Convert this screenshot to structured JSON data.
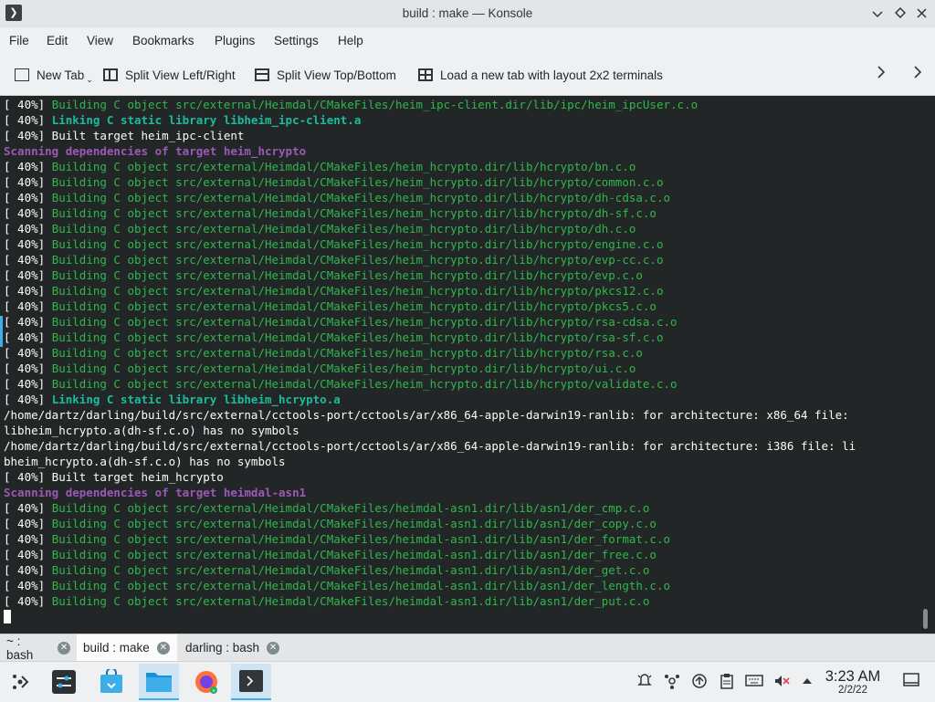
{
  "window": {
    "title": "build : make — Konsole",
    "app_icon": "terminal-icon",
    "controls": [
      "chevron-down-icon",
      "diamond-icon",
      "close-icon"
    ]
  },
  "menu": [
    "File",
    "Edit",
    "View",
    "Bookmarks",
    "Plugins",
    "Settings",
    "Help"
  ],
  "toolbar": {
    "new_tab": "New Tab",
    "split_lr": "Split View Left/Right",
    "split_tb": "Split View Top/Bottom",
    "layout_2x2": "Load a new tab with layout 2x2 terminals"
  },
  "terminal": {
    "lines": [
      {
        "prefix": "[ 40%] ",
        "text": "Building C object src/external/Heimdal/CMakeFiles/heim_ipc-client.dir/lib/ipc/heim_ipcUser.c.o",
        "style": "green"
      },
      {
        "prefix": "[ 40%] ",
        "text": "Linking C static library libheim_ipc-client.a",
        "style": "teal"
      },
      {
        "prefix": "",
        "text": "[ 40%] Built target heim_ipc-client",
        "style": "white"
      },
      {
        "prefix": "",
        "text": "Scanning dependencies of target heim_hcrypto",
        "style": "purple"
      },
      {
        "prefix": "[ 40%] ",
        "text": "Building C object src/external/Heimdal/CMakeFiles/heim_hcrypto.dir/lib/hcrypto/bn.c.o",
        "style": "green"
      },
      {
        "prefix": "[ 40%] ",
        "text": "Building C object src/external/Heimdal/CMakeFiles/heim_hcrypto.dir/lib/hcrypto/common.c.o",
        "style": "green"
      },
      {
        "prefix": "[ 40%] ",
        "text": "Building C object src/external/Heimdal/CMakeFiles/heim_hcrypto.dir/lib/hcrypto/dh-cdsa.c.o",
        "style": "green"
      },
      {
        "prefix": "[ 40%] ",
        "text": "Building C object src/external/Heimdal/CMakeFiles/heim_hcrypto.dir/lib/hcrypto/dh-sf.c.o",
        "style": "green"
      },
      {
        "prefix": "[ 40%] ",
        "text": "Building C object src/external/Heimdal/CMakeFiles/heim_hcrypto.dir/lib/hcrypto/dh.c.o",
        "style": "green"
      },
      {
        "prefix": "[ 40%] ",
        "text": "Building C object src/external/Heimdal/CMakeFiles/heim_hcrypto.dir/lib/hcrypto/engine.c.o",
        "style": "green"
      },
      {
        "prefix": "[ 40%] ",
        "text": "Building C object src/external/Heimdal/CMakeFiles/heim_hcrypto.dir/lib/hcrypto/evp-cc.c.o",
        "style": "green"
      },
      {
        "prefix": "[ 40%] ",
        "text": "Building C object src/external/Heimdal/CMakeFiles/heim_hcrypto.dir/lib/hcrypto/evp.c.o",
        "style": "green"
      },
      {
        "prefix": "[ 40%] ",
        "text": "Building C object src/external/Heimdal/CMakeFiles/heim_hcrypto.dir/lib/hcrypto/pkcs12.c.o",
        "style": "green"
      },
      {
        "prefix": "[ 40%] ",
        "text": "Building C object src/external/Heimdal/CMakeFiles/heim_hcrypto.dir/lib/hcrypto/pkcs5.c.o",
        "style": "green"
      },
      {
        "prefix": "[ 40%] ",
        "text": "Building C object src/external/Heimdal/CMakeFiles/heim_hcrypto.dir/lib/hcrypto/rsa-cdsa.c.o",
        "style": "green"
      },
      {
        "prefix": "[ 40%] ",
        "text": "Building C object src/external/Heimdal/CMakeFiles/heim_hcrypto.dir/lib/hcrypto/rsa-sf.c.o",
        "style": "green"
      },
      {
        "prefix": "[ 40%] ",
        "text": "Building C object src/external/Heimdal/CMakeFiles/heim_hcrypto.dir/lib/hcrypto/rsa.c.o",
        "style": "green"
      },
      {
        "prefix": "[ 40%] ",
        "text": "Building C object src/external/Heimdal/CMakeFiles/heim_hcrypto.dir/lib/hcrypto/ui.c.o",
        "style": "green"
      },
      {
        "prefix": "[ 40%] ",
        "text": "Building C object src/external/Heimdal/CMakeFiles/heim_hcrypto.dir/lib/hcrypto/validate.c.o",
        "style": "green"
      },
      {
        "prefix": "[ 40%] ",
        "text": "Linking C static library libheim_hcrypto.a",
        "style": "teal"
      },
      {
        "prefix": "",
        "text": "/home/dartz/darling/build/src/external/cctools-port/cctools/ar/x86_64-apple-darwin19-ranlib: for architecture: x86_64 file:",
        "style": "white"
      },
      {
        "prefix": "",
        "text": "libheim_hcrypto.a(dh-sf.c.o) has no symbols",
        "style": "white"
      },
      {
        "prefix": "",
        "text": "/home/dartz/darling/build/src/external/cctools-port/cctools/ar/x86_64-apple-darwin19-ranlib: for architecture: i386 file: li",
        "style": "white"
      },
      {
        "prefix": "",
        "text": "bheim_hcrypto.a(dh-sf.c.o) has no symbols",
        "style": "white"
      },
      {
        "prefix": "",
        "text": "[ 40%] Built target heim_hcrypto",
        "style": "white"
      },
      {
        "prefix": "",
        "text": "Scanning dependencies of target heimdal-asn1",
        "style": "purple"
      },
      {
        "prefix": "[ 40%] ",
        "text": "Building C object src/external/Heimdal/CMakeFiles/heimdal-asn1.dir/lib/asn1/der_cmp.c.o",
        "style": "green"
      },
      {
        "prefix": "[ 40%] ",
        "text": "Building C object src/external/Heimdal/CMakeFiles/heimdal-asn1.dir/lib/asn1/der_copy.c.o",
        "style": "green"
      },
      {
        "prefix": "[ 40%] ",
        "text": "Building C object src/external/Heimdal/CMakeFiles/heimdal-asn1.dir/lib/asn1/der_format.c.o",
        "style": "green"
      },
      {
        "prefix": "[ 40%] ",
        "text": "Building C object src/external/Heimdal/CMakeFiles/heimdal-asn1.dir/lib/asn1/der_free.c.o",
        "style": "green"
      },
      {
        "prefix": "[ 40%] ",
        "text": "Building C object src/external/Heimdal/CMakeFiles/heimdal-asn1.dir/lib/asn1/der_get.c.o",
        "style": "green"
      },
      {
        "prefix": "[ 40%] ",
        "text": "Building C object src/external/Heimdal/CMakeFiles/heimdal-asn1.dir/lib/asn1/der_length.c.o",
        "style": "green"
      },
      {
        "prefix": "[ 40%] ",
        "text": "Building C object src/external/Heimdal/CMakeFiles/heimdal-asn1.dir/lib/asn1/der_put.c.o",
        "style": "green"
      }
    ]
  },
  "tabs": [
    {
      "label": "~ : bash",
      "active": false
    },
    {
      "label": "build : make",
      "active": true
    },
    {
      "label": "darling : bash",
      "active": false
    }
  ],
  "taskbar": {
    "apps": [
      {
        "name": "application-launcher-icon",
        "running": false
      },
      {
        "name": "system-settings-icon",
        "running": false
      },
      {
        "name": "discover-store-icon",
        "running": false
      },
      {
        "name": "file-manager-icon",
        "running": true
      },
      {
        "name": "firefox-icon",
        "running": false
      },
      {
        "name": "konsole-icon",
        "running": true
      }
    ],
    "tray": [
      "notifications-icon",
      "kde-connect-icon",
      "updates-icon",
      "clipboard-icon",
      "keyboard-icon",
      "volume-muted-icon",
      "tray-expand-icon"
    ],
    "clock": {
      "time": "3:23 AM",
      "date": "2/2/22"
    }
  }
}
